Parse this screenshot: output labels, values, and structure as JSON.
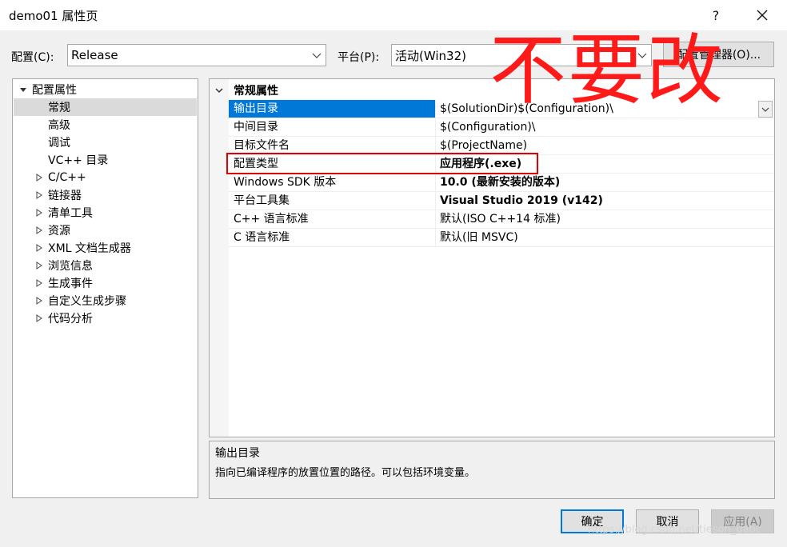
{
  "window": {
    "title": "demo01 属性页",
    "help_label": "?",
    "close_label": "✕"
  },
  "config_bar": {
    "config_label": "配置(C):",
    "config_value": "Release",
    "platform_label": "平台(P):",
    "platform_value": "活动(Win32)",
    "manager_button": "配置管理器(O)..."
  },
  "tree": {
    "root": "配置属性",
    "children": [
      "常规",
      "高级",
      "调试",
      "VC++ 目录"
    ],
    "groups": [
      "C/C++",
      "链接器",
      "清单工具",
      "资源",
      "XML 文档生成器",
      "浏览信息",
      "生成事件",
      "自定义生成步骤",
      "代码分析"
    ]
  },
  "grid": {
    "category": "常规属性",
    "rows": [
      {
        "name": "输出目录",
        "value": "$(SolutionDir)$(Configuration)\\"
      },
      {
        "name": "中间目录",
        "value": "$(Configuration)\\"
      },
      {
        "name": "目标文件名",
        "value": "$(ProjectName)"
      },
      {
        "name": "配置类型",
        "value": "应用程序(.exe)"
      },
      {
        "name": "Windows SDK 版本",
        "value": "10.0 (最新安装的版本)"
      },
      {
        "name": "平台工具集",
        "value": "Visual Studio 2019 (v142)"
      },
      {
        "name": "C++ 语言标准",
        "value": "默认(ISO C++14 标准)"
      },
      {
        "name": "C 语言标准",
        "value": "默认(旧 MSVC)"
      }
    ]
  },
  "description": {
    "title": "输出目录",
    "text": "指向已编译程序的放置位置的路径。可以包括环境变量。"
  },
  "buttons": {
    "ok": "确定",
    "cancel": "取消",
    "apply": "应用(A)"
  },
  "annotation": {
    "text": "不要改"
  },
  "watermark": "https://blog.csdn.net/tieson_uabc",
  "colors": {
    "selection": "#0078d7",
    "annotation_red": "#ff1a1a"
  }
}
